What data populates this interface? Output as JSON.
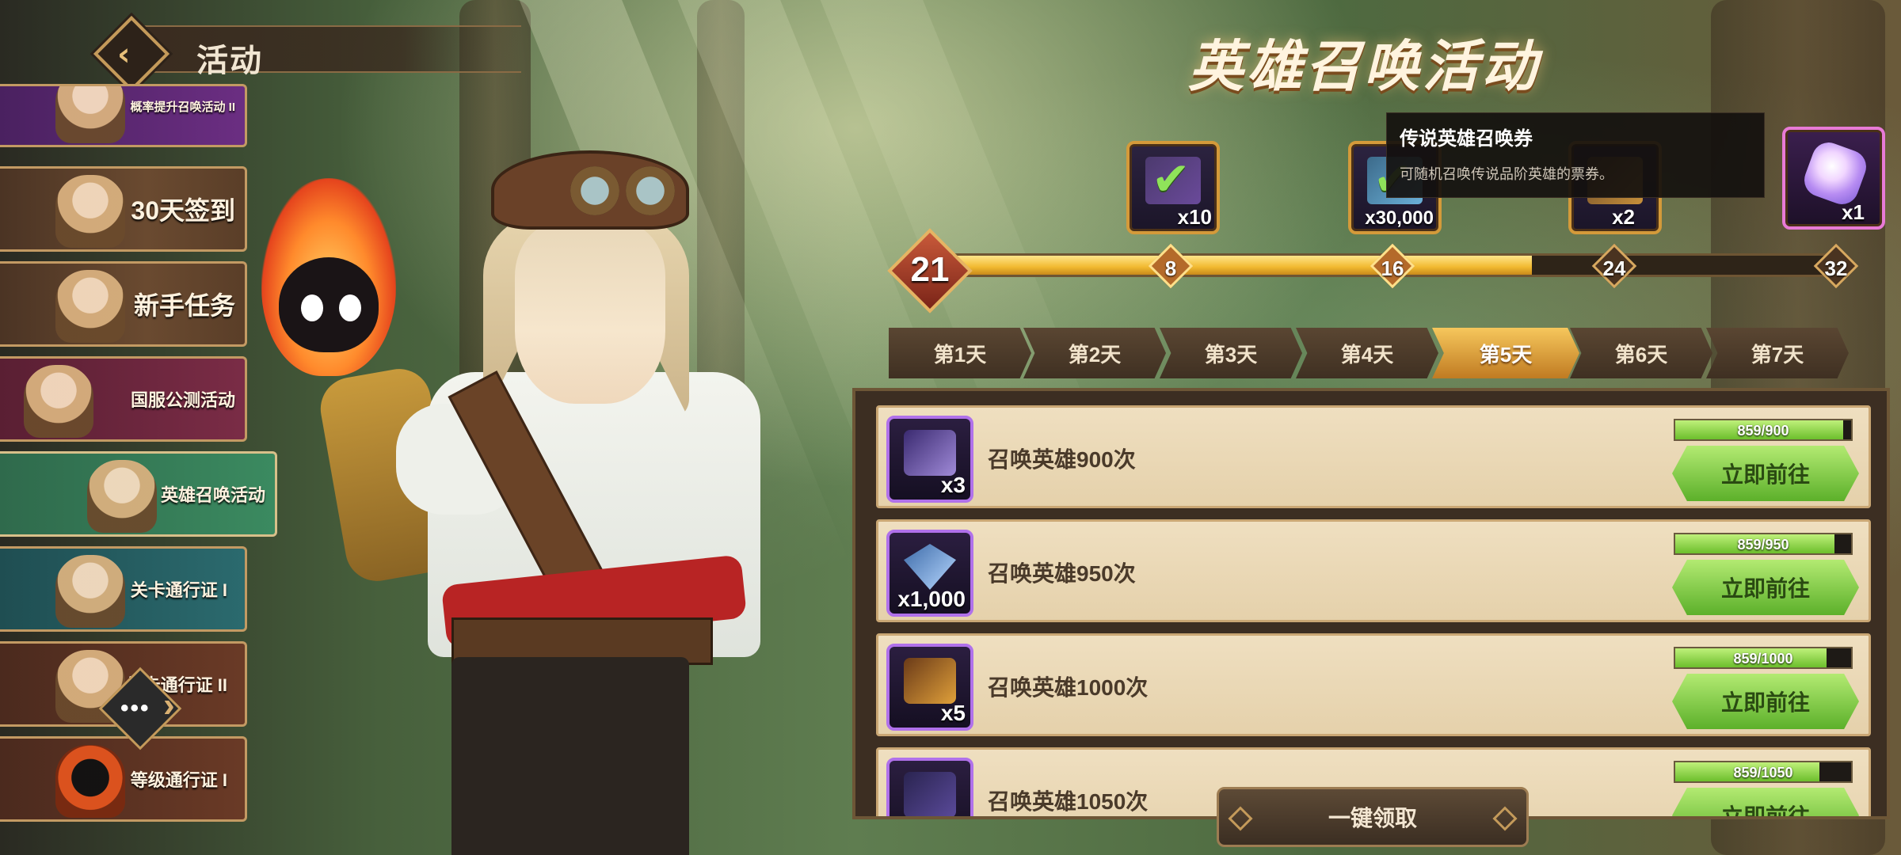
{
  "header": {
    "title": "活动"
  },
  "sidebar": {
    "items": [
      {
        "label": "概率提升召唤活动 II"
      },
      {
        "label": "30天签到"
      },
      {
        "label": "新手任务"
      },
      {
        "label": "国服公测活动"
      },
      {
        "label": "英雄召唤活动",
        "active": true
      },
      {
        "label": "关卡通行证 I"
      },
      {
        "label": "关卡通行证 II"
      },
      {
        "label": "等级通行证 I"
      }
    ]
  },
  "event": {
    "title": "英雄召唤活动",
    "progress": {
      "current": "21",
      "current_value": 21,
      "max_value": 32
    },
    "milestones": [
      {
        "label": "8",
        "reward_qty": "x10",
        "claimed": true
      },
      {
        "label": "16",
        "reward_qty": "x30,000",
        "claimed": true
      },
      {
        "label": "24",
        "reward_qty": "x2",
        "claimed": false
      },
      {
        "label": "32",
        "reward_qty": "x1",
        "claimed": false
      }
    ],
    "tooltip": {
      "title": "传说英雄召唤券",
      "description": "可随机召唤传说品阶英雄的票券。"
    }
  },
  "days": {
    "tabs": [
      "第1天",
      "第2天",
      "第3天",
      "第4天",
      "第5天",
      "第6天",
      "第7天"
    ],
    "active": "第5天"
  },
  "tasks": [
    {
      "name": "召唤英雄900次",
      "reward_qty": "x3",
      "progress_text": "859/900",
      "progress": 0.954,
      "button": "立即前往"
    },
    {
      "name": "召唤英雄950次",
      "reward_qty": "x1,000",
      "progress_text": "859/950",
      "progress": 0.904,
      "button": "立即前往"
    },
    {
      "name": "召唤英雄1000次",
      "reward_qty": "x5",
      "progress_text": "859/1000",
      "progress": 0.859,
      "button": "立即前往"
    },
    {
      "name": "召唤英雄1050次",
      "reward_qty": "",
      "progress_text": "859/1050",
      "progress": 0.818,
      "button": "立即前往"
    }
  ],
  "claim_all": {
    "label": "一键领取"
  },
  "colors": {
    "accent_gold": "#f1b930",
    "go_green": "#5cb02a",
    "panel_bg": "#3c2e22"
  }
}
